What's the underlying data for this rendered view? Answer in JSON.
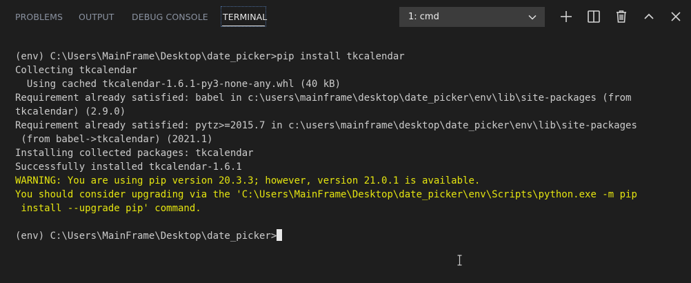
{
  "panel": {
    "tabs": [
      {
        "label": "PROBLEMS"
      },
      {
        "label": "OUTPUT"
      },
      {
        "label": "DEBUG CONSOLE"
      },
      {
        "label": "TERMINAL"
      }
    ],
    "terminal_select": {
      "value": "1: cmd"
    },
    "actions": [
      {
        "icon": "plus-icon"
      },
      {
        "icon": "split-terminal-icon"
      },
      {
        "icon": "trash-icon"
      },
      {
        "icon": "chevron-up-icon"
      },
      {
        "icon": "close-icon"
      }
    ]
  },
  "terminal": {
    "lines": [
      {
        "text": "(env) C:\\Users\\MainFrame\\Desktop\\date_picker>pip install tkcalendar"
      },
      {
        "text": "Collecting tkcalendar"
      },
      {
        "text": "  Using cached tkcalendar-1.6.1-py3-none-any.whl (40 kB)"
      },
      {
        "text": "Requirement already satisfied: babel in c:\\users\\mainframe\\desktop\\date_picker\\env\\lib\\site-packages (from"
      },
      {
        "text": "tkcalendar) (2.9.0)"
      },
      {
        "text": "Requirement already satisfied: pytz>=2015.7 in c:\\users\\mainframe\\desktop\\date_picker\\env\\lib\\site-packages"
      },
      {
        "text": " (from babel->tkcalendar) (2021.1)"
      },
      {
        "text": "Installing collected packages: tkcalendar"
      },
      {
        "text": "Successfully installed tkcalendar-1.6.1"
      },
      {
        "text": "WARNING: You are using pip version 20.3.3; however, version 21.0.1 is available."
      },
      {
        "text": "You should consider upgrading via the 'C:\\Users\\MainFrame\\Desktop\\date_picker\\env\\Scripts\\python.exe -m pip"
      },
      {
        "text": " install --upgrade pip' command."
      },
      {
        "text": ""
      },
      {
        "text": "(env) C:\\Users\\MainFrame\\Desktop\\date_picker>"
      }
    ]
  },
  "colors": {
    "background": "#1e1e1e",
    "text": "#cccccc",
    "warning": "#e5e510",
    "tab_inactive": "#8a92a0",
    "tab_active": "#e7e7e7",
    "select_bg": "#3c3c3c"
  }
}
